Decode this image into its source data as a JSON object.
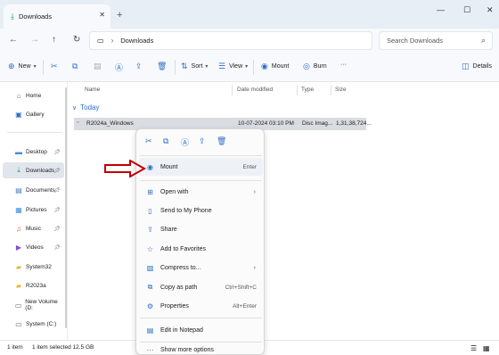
{
  "window": {
    "tab_title": "Downloads",
    "tab_close": "✕",
    "new_tab": "+",
    "minimize": "—",
    "maximize": "☐",
    "close": "✕"
  },
  "address": {
    "path": "Downloads",
    "search_placeholder": "Search Downloads"
  },
  "toolbar": {
    "new_label": "New",
    "sort_label": "Sort",
    "view_label": "View",
    "mount_label": "Mount",
    "burn_label": "Burn",
    "more_label": "···",
    "details_label": "Details"
  },
  "sidebar": {
    "items": [
      {
        "label": "Home",
        "icon": "home-icon",
        "glyph": "⌂",
        "color": "#2f6ec8"
      },
      {
        "label": "Gallery",
        "icon": "gallery-icon",
        "glyph": "▣",
        "color": "#2f6ec8"
      },
      {
        "label": "Desktop",
        "icon": "desktop-icon",
        "glyph": "▬",
        "color": "#3a8ee0"
      },
      {
        "label": "Downloads",
        "icon": "downloads-icon",
        "glyph": "⤓",
        "color": "#19a36a"
      },
      {
        "label": "Documents",
        "icon": "documents-icon",
        "glyph": "▤",
        "color": "#4a78c8"
      },
      {
        "label": "Pictures",
        "icon": "pictures-icon",
        "glyph": "▦",
        "color": "#3a8ee0"
      },
      {
        "label": "Music",
        "icon": "music-icon",
        "glyph": "♫",
        "color": "#e05a3a"
      },
      {
        "label": "Videos",
        "icon": "videos-icon",
        "glyph": "▶",
        "color": "#8a4ad8"
      },
      {
        "label": "System32",
        "icon": "folder-icon",
        "glyph": "▰",
        "color": "#e8b530"
      },
      {
        "label": "R2023a",
        "icon": "folder-icon",
        "glyph": "▰",
        "color": "#e8b530"
      },
      {
        "label": "New Volume (D:",
        "icon": "drive-icon",
        "glyph": "▭",
        "color": "#666666"
      },
      {
        "label": "System (C:)",
        "icon": "drive-icon",
        "glyph": "▭",
        "color": "#666666"
      }
    ]
  },
  "columns": {
    "name": "Name",
    "date": "Date modified",
    "type": "Type",
    "size": "Size"
  },
  "group_label": "Today",
  "file": {
    "name": "R2024a_Windows",
    "date": "10-07-2024 03:10 PM",
    "type": "Disc Imag...",
    "size": "1,31,38,724..."
  },
  "status": {
    "count": "1 item",
    "selected": "1 item selected 12.5 GB"
  },
  "context_menu": {
    "items": [
      {
        "label": "Mount",
        "shortcut": "Enter",
        "icon": "mount-icon",
        "glyph": "◉"
      },
      {
        "label": "Open with",
        "shortcut": "",
        "icon": "open-with-icon",
        "glyph": "⊞",
        "submenu": true
      },
      {
        "label": "Send to My Phone",
        "shortcut": "",
        "icon": "phone-icon",
        "glyph": "▯"
      },
      {
        "label": "Share",
        "shortcut": "",
        "icon": "share-icon",
        "glyph": "⇪"
      },
      {
        "label": "Add to Favorites",
        "shortcut": "",
        "icon": "star-icon",
        "glyph": "☆"
      },
      {
        "label": "Compress to...",
        "shortcut": "",
        "icon": "compress-icon",
        "glyph": "▧",
        "submenu": true
      },
      {
        "label": "Copy as path",
        "shortcut": "Ctrl+Shift+C",
        "icon": "copy-path-icon",
        "glyph": "⧉"
      },
      {
        "label": "Properties",
        "shortcut": "Alt+Enter",
        "icon": "properties-icon",
        "glyph": "⚙"
      },
      {
        "label": "Edit in Notepad",
        "shortcut": "",
        "icon": "notepad-icon",
        "glyph": "▤"
      },
      {
        "label": "Show more options",
        "shortcut": "",
        "icon": "more-options-icon",
        "glyph": "⋯"
      }
    ]
  },
  "colors": {
    "accent": "#2f6ec8",
    "annotation": "#c00000"
  }
}
